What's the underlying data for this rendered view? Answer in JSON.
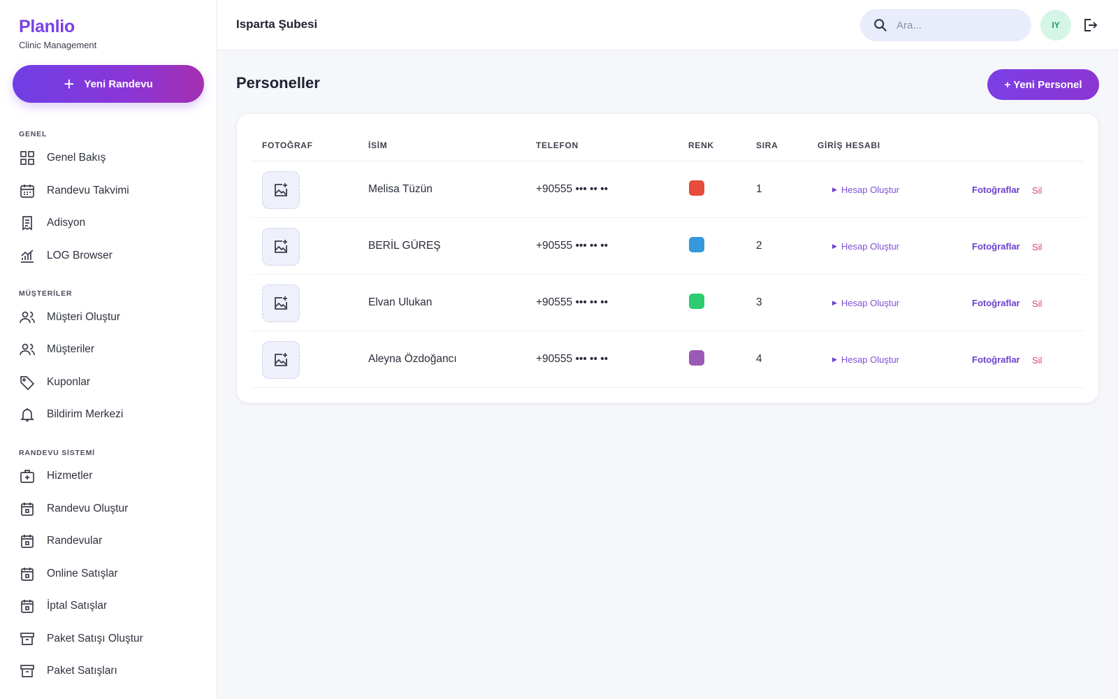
{
  "brand": {
    "name": "Planlio",
    "subtitle": "Clinic Management"
  },
  "sidebar": {
    "new_appointment_label": "Yeni Randevu",
    "sections": [
      {
        "label": "GENEL",
        "items": [
          {
            "label": "Genel Bakış",
            "icon": "grid-icon"
          },
          {
            "label": "Randevu Takvimi",
            "icon": "calendar-icon"
          },
          {
            "label": "Adisyon",
            "icon": "receipt-icon"
          },
          {
            "label": "LOG Browser",
            "icon": "chart-icon"
          }
        ]
      },
      {
        "label": "MÜŞTERİLER",
        "items": [
          {
            "label": "Müşteri Oluştur",
            "icon": "users-icon"
          },
          {
            "label": "Müşteriler",
            "icon": "users-icon"
          },
          {
            "label": "Kuponlar",
            "icon": "tag-icon"
          },
          {
            "label": "Bildirim Merkezi",
            "icon": "bell-icon"
          }
        ]
      },
      {
        "label": "RANDEVU SİSTEMİ",
        "items": [
          {
            "label": "Hizmetler",
            "icon": "medical-bag-icon"
          },
          {
            "label": "Randevu Oluştur",
            "icon": "calendar-event-icon"
          },
          {
            "label": "Randevular",
            "icon": "calendar-event-icon"
          },
          {
            "label": "Online Satışlar",
            "icon": "calendar-event-icon"
          },
          {
            "label": "İptal Satışlar",
            "icon": "calendar-event-icon"
          },
          {
            "label": "Paket Satışı Oluştur",
            "icon": "archive-icon"
          },
          {
            "label": "Paket Satışları",
            "icon": "archive-icon"
          }
        ]
      }
    ]
  },
  "topbar": {
    "branch": "Isparta Şubesi",
    "search_placeholder": "Ara...",
    "avatar_initials": "IY"
  },
  "page": {
    "title": "Personeller",
    "new_staff_label": "+ Yeni Personel"
  },
  "table": {
    "columns": [
      "FOTOĞRAF",
      "İSİM",
      "TELEFON",
      "RENK",
      "SIRA",
      "GİRİŞ HESABI"
    ],
    "action_create_account": "Hesap Oluştur",
    "action_photos": "Fotoğraflar",
    "action_delete": "Sil",
    "rows": [
      {
        "name": "Melisa Tüzün",
        "phone": "+90555 ••• •• ••",
        "color": "#e74c3c",
        "order": "1"
      },
      {
        "name": "BERİL GÜREŞ",
        "phone": "+90555 ••• •• ••",
        "color": "#3498db",
        "order": "2"
      },
      {
        "name": "Elvan Ulukan",
        "phone": "+90555 ••• •• ••",
        "color": "#2ecc71",
        "order": "3"
      },
      {
        "name": "Aleyna Özdoğancı",
        "phone": "+90555 ••• •• ••",
        "color": "#9b59b6",
        "order": "4"
      }
    ]
  },
  "colors": {
    "accent": "#7b3fe4",
    "delete": "#d14a6a"
  }
}
